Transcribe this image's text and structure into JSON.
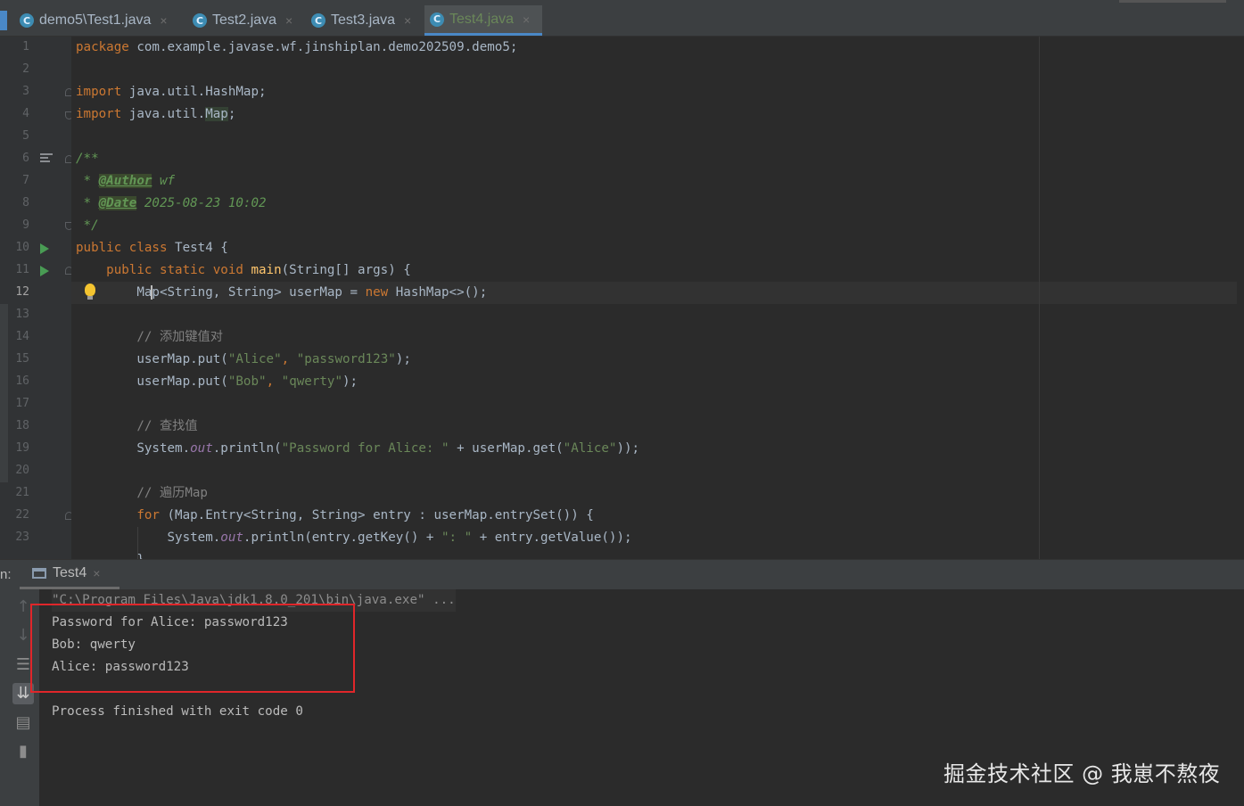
{
  "tabs": [
    {
      "label": "demo5\\Test1.java",
      "close": "×",
      "icon": "java-class-icon"
    },
    {
      "label": "Test2.java",
      "close": "×",
      "icon": "java-class-icon"
    },
    {
      "label": "Test3.java",
      "close": "×",
      "icon": "java-class-icon"
    },
    {
      "label": "Test4.java",
      "close": "×",
      "icon": "java-class-icon",
      "active": true
    }
  ],
  "editor": {
    "current_line": 12,
    "line_numbers": [
      "1",
      "2",
      "3",
      "4",
      "5",
      "6",
      "7",
      "8",
      "9",
      "10",
      "11",
      "12",
      "13",
      "14",
      "15",
      "16",
      "17",
      "18",
      "19",
      "20",
      "21",
      "22",
      "23"
    ],
    "code": {
      "l1_kw": "package",
      "l1_rest": " com.example.javase.wf.jinshiplan.demo202509.demo5;",
      "l3_kw": "import",
      "l3_rest": " java.util.HashMap;",
      "l4_kw": "import",
      "l4_rest": " java.util.",
      "l4_cls": "Map",
      "l4_end": ";",
      "l6": "/**",
      "l7_star": " * ",
      "l7_tag": "@Author",
      "l7_val": " wf",
      "l8_star": " * ",
      "l8_tag": "@Date",
      "l8_val": " 2025-08-23 10:02",
      "l9": " */",
      "l10_kw": "public class",
      "l10_rest": " Test4 {",
      "l11_kw": "    public static void",
      "l11_fn": " main",
      "l11_rest": "(String[] args) {",
      "l12_a": "        Ma",
      "l12_b": "p<String, String> userMap = ",
      "l12_kw": "new",
      "l12_rest": " HashMap<>();",
      "l14": "        // 添加键值对",
      "l15_a": "        userMap.put(",
      "l15_s1": "\"Alice\"",
      "l15_c": ", ",
      "l15_s2": "\"password123\"",
      "l15_e": ");",
      "l16_a": "        userMap.put(",
      "l16_s1": "\"Bob\"",
      "l16_c": ", ",
      "l16_s2": "\"qwerty\"",
      "l16_e": ");",
      "l18": "        // 查找值",
      "l19_a": "        System.",
      "l19_out": "out",
      "l19_b": ".println(",
      "l19_s": "\"Password for Alice: \"",
      "l19_c": " + userMap.get(",
      "l19_s2": "\"Alice\"",
      "l19_e": "));",
      "l21": "        // 遍历Map",
      "l22_kw": "        for",
      "l22_rest": " (Map.Entry<String, String> entry : userMap.entrySet()) {",
      "l23_a": "            System.",
      "l23_out": "out",
      "l23_b": ".println(entry.getKey() + ",
      "l23_s": "\": \"",
      "l23_e": " + entry.getValue());",
      "l24_partial": "        }"
    }
  },
  "run_panel": {
    "label": "n:",
    "tab_label": "Test4",
    "tab_close": "×",
    "command": "\"C:\\Program Files\\Java\\jdk1.8.0_201\\bin\\java.exe\" ...",
    "output": [
      "Password for Alice: password123",
      "Bob: qwerty",
      "Alice: password123"
    ],
    "exit_message": "Process finished with exit code 0",
    "toolbar_icons": [
      "up-arrow-icon",
      "down-arrow-icon",
      "soft-wrap-icon",
      "scroll-to-end-icon",
      "print-icon",
      "trash-icon"
    ]
  },
  "watermark": "掘金技术社区 @ 我崽不熬夜",
  "colors": {
    "background": "#2B2B2B",
    "keyword": "#CC7832",
    "string": "#6A8759",
    "comment": "#808080",
    "highlight_box": "#E0262A",
    "accent": "#4A88C7"
  }
}
